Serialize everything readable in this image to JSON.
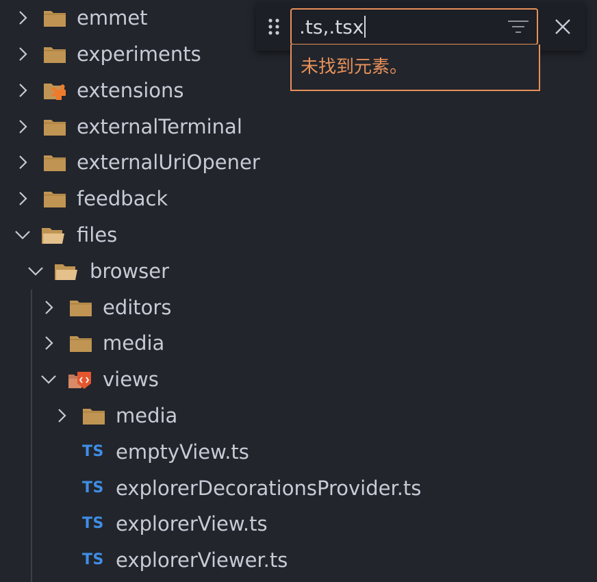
{
  "tree": {
    "items": [
      {
        "label": "emmet",
        "expanded": false,
        "icon": "folder-icon"
      },
      {
        "label": "experiments",
        "expanded": false,
        "icon": "folder-icon"
      },
      {
        "label": "extensions",
        "expanded": false,
        "icon": "extensions-folder-icon"
      },
      {
        "label": "externalTerminal",
        "expanded": false,
        "icon": "folder-icon"
      },
      {
        "label": "externalUriOpener",
        "expanded": false,
        "icon": "folder-icon"
      },
      {
        "label": "feedback",
        "expanded": false,
        "icon": "folder-icon"
      },
      {
        "label": "files",
        "expanded": true,
        "icon": "folder-open-icon"
      },
      {
        "label": "browser",
        "expanded": true,
        "icon": "folder-open-icon"
      },
      {
        "label": "editors",
        "expanded": false,
        "icon": "folder-icon"
      },
      {
        "label": "media",
        "expanded": false,
        "icon": "folder-icon"
      },
      {
        "label": "views",
        "expanded": true,
        "icon": "views-folder-icon"
      },
      {
        "label": "media",
        "expanded": false,
        "icon": "folder-icon"
      },
      {
        "label": "emptyView.ts",
        "icon": "typescript-file-icon",
        "badge": "TS"
      },
      {
        "label": "explorerDecorationsProvider.ts",
        "icon": "typescript-file-icon",
        "badge": "TS"
      },
      {
        "label": "explorerView.ts",
        "icon": "typescript-file-icon",
        "badge": "TS"
      },
      {
        "label": "explorerViewer.ts",
        "icon": "typescript-file-icon",
        "badge": "TS"
      }
    ]
  },
  "find": {
    "value": ".ts,.tsx",
    "message": "未找到元素。",
    "drag_icon": "drag-handle-icon",
    "filter_icon": "filter-icon",
    "close_icon": "close-icon"
  },
  "colors": {
    "background": "#22252c",
    "text": "#c6cbd6",
    "folder": "#c09553",
    "accent_orange": "#e8915a",
    "typescript_blue": "#3f8ee5"
  }
}
